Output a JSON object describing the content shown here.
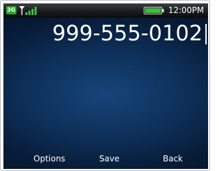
{
  "status_bar": {
    "network_badge": "3G",
    "signal_icon": "signal-bars-icon",
    "battery_icon": "battery-icon",
    "time": "12:00PM",
    "colors": {
      "badge": "#29a82b",
      "battery": "#39c23a"
    }
  },
  "dialer": {
    "number": "999-555-0102"
  },
  "softkeys": {
    "left": "Options",
    "center": "Save",
    "right": "Back"
  }
}
